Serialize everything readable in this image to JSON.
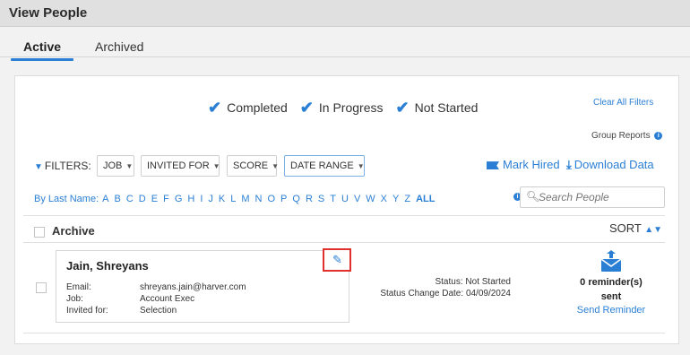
{
  "header": {
    "title": "View People"
  },
  "tabs": [
    {
      "label": "Active",
      "active": true
    },
    {
      "label": "Archived",
      "active": false
    }
  ],
  "status_filters": [
    {
      "label": "Completed",
      "checked": true
    },
    {
      "label": "In Progress",
      "checked": true
    },
    {
      "label": "Not Started",
      "checked": true
    }
  ],
  "clear_all_label": "Clear All Filters",
  "group_reports_label": "Group Reports",
  "filters": {
    "label": "FILTERS:",
    "dropdowns": [
      {
        "label": "JOB"
      },
      {
        "label": "INVITED FOR"
      },
      {
        "label": "SCORE"
      },
      {
        "label": "DATE RANGE"
      }
    ]
  },
  "actions": {
    "mark_hired_label": "Mark Hired",
    "download_label": "Download Data"
  },
  "last_name_filter": {
    "prefix": "By Last Name:",
    "letters": [
      "A",
      "B",
      "C",
      "D",
      "E",
      "F",
      "G",
      "H",
      "I",
      "J",
      "K",
      "L",
      "M",
      "N",
      "O",
      "P",
      "Q",
      "R",
      "S",
      "T",
      "U",
      "V",
      "W",
      "X",
      "Y",
      "Z"
    ],
    "all_label": "ALL"
  },
  "search": {
    "placeholder": "Search People"
  },
  "list_header": {
    "archive_label": "Archive",
    "sort_label": "SORT"
  },
  "people": [
    {
      "name": "Jain, Shreyans",
      "email_label": "Email:",
      "email": "shreyans.jain@harver.com",
      "job_label": "Job:",
      "job": "Account Exec",
      "invited_label": "Invited for:",
      "invited_for": "Selection",
      "status_label": "Status:",
      "status": "Not Started",
      "status_change_label": "Status Change Date:",
      "status_change_date": "04/09/2024",
      "reminders": "0 reminder(s)",
      "reminders_suffix": "sent",
      "send_reminder_label": "Send Reminder"
    }
  ],
  "colors": {
    "accent": "#2a7fd4",
    "highlight": "#e0312f"
  },
  "icons": [
    "filter-icon",
    "flag-icon",
    "download-icon",
    "info-icon",
    "search-icon",
    "sort-icon",
    "pencil-icon",
    "envelope-icon",
    "caret-down-icon"
  ]
}
